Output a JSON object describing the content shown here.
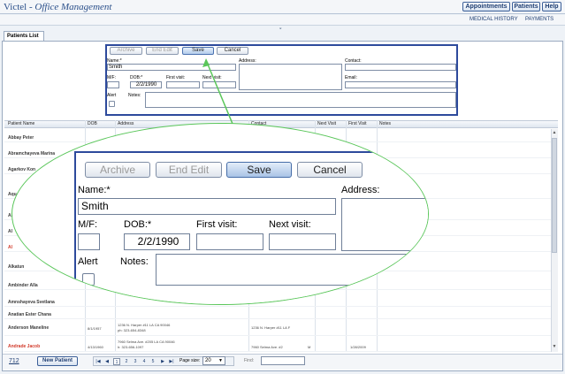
{
  "app": {
    "brand": "Victel",
    "separator": " - ",
    "module": "Office Management"
  },
  "top_buttons": {
    "appointments": "Appointments",
    "patients": "Patients",
    "help": "Help"
  },
  "subnav": {
    "medical_history": "MEDICAL HISTORY",
    "payments": "PAYMENTS"
  },
  "tab": {
    "label": "Patients List"
  },
  "form": {
    "buttons": {
      "archive": "Archive",
      "end_edit": "End Edit",
      "save": "Save",
      "cancel": "Cancel"
    },
    "labels": {
      "name": "Name:*",
      "address": "Address:",
      "contact": "Contact:",
      "email": "Email:",
      "mf": "M/F:",
      "dob": "DOB:*",
      "first_visit": "First visit:",
      "next_visit": "Next visit:",
      "alert": "Alert",
      "notes": "Notes:"
    },
    "values": {
      "name": "Smith",
      "dob": "2/2/1990"
    }
  },
  "grid": {
    "columns": {
      "patient_name": "Patient Name",
      "dob": "DOB",
      "address": "Address",
      "contact": "Contact",
      "next_visit": "Next Visit",
      "first_visit": "First Visit",
      "notes": "Notes"
    },
    "rows": [
      {
        "name": "Abbay Peter"
      },
      {
        "name": "Abramchayeva Marina"
      },
      {
        "name": "Agarkov Kon"
      },
      {
        "name": "Aqu"
      },
      {
        "name": "Al"
      },
      {
        "name": "Al"
      },
      {
        "name": "Al"
      },
      {
        "name": "Alkatun"
      },
      {
        "name": "Ambinder Alla"
      },
      {
        "name": "Amnshayeva Svetlana"
      },
      {
        "name": "Anatian Ester Chana"
      },
      {
        "name": "Anderson Maneline",
        "dob": "8/1/1957",
        "address": "1236 N. Harper #11  LA CA 90046",
        "address_line2": "ph: 323-654-8348",
        "contact": "1236 N. Harper #11  LA  F"
      },
      {
        "name": "Andrade Jacob",
        "dob": "4/13/1960",
        "address": "7960 Selma Ave. #205 LA CA 90046",
        "address_line2": "h: 323-656-1097",
        "contact": "7960 Selma Ave. #2",
        "contact_extra": "M",
        "first_visit": "1/28/2009"
      }
    ]
  },
  "footer": {
    "count": "712",
    "new_patient": "New Patient",
    "pager": {
      "first": "|◀",
      "prev": "◀",
      "pages": [
        "1",
        "2",
        "3",
        "4",
        "5"
      ],
      "next": "▶",
      "last": "▶|"
    },
    "page_size_label": "Page size:",
    "page_size": "20",
    "find_label": "Find:"
  },
  "colors": {
    "accent": "#2d4a9c",
    "callout": "#5ac65a",
    "alert_name": "#d23a2a"
  }
}
